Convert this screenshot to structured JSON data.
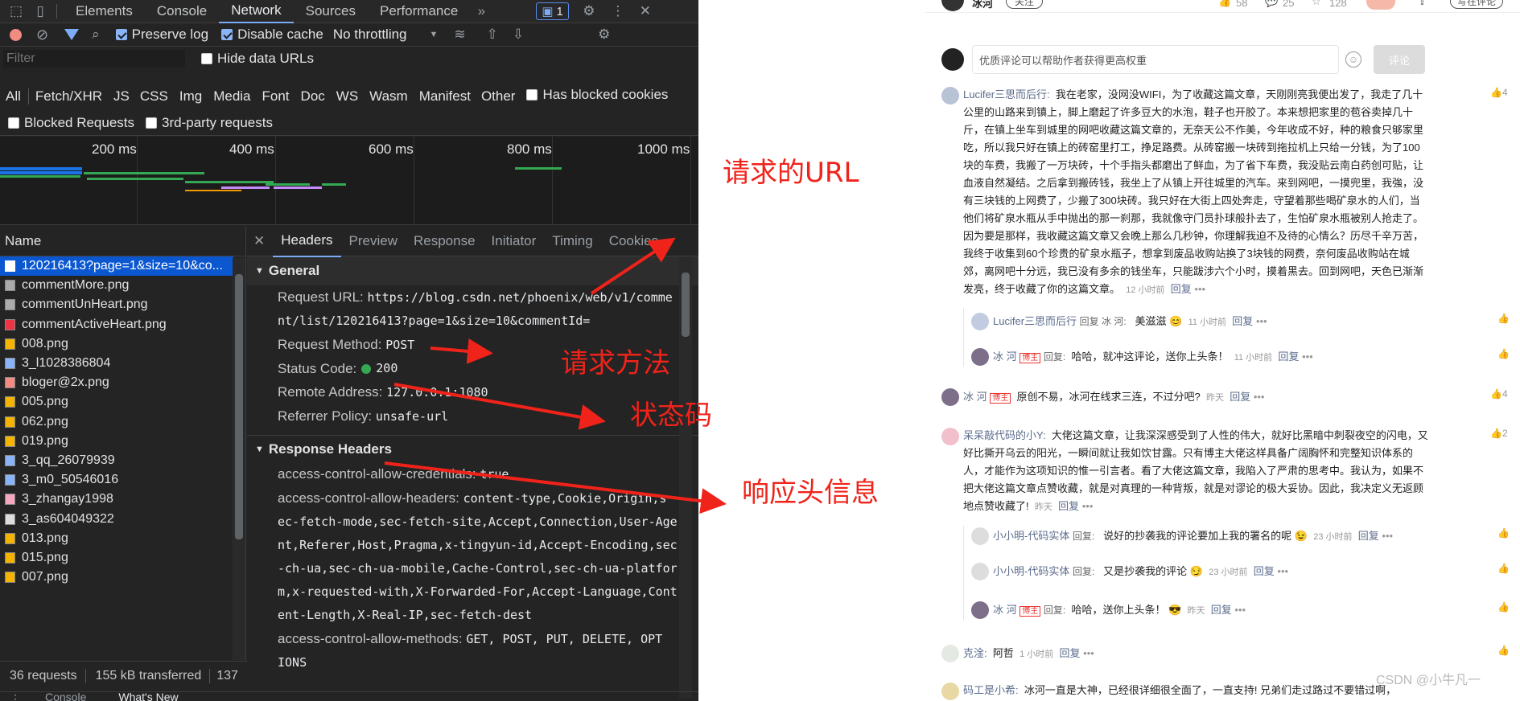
{
  "devtools": {
    "top_tabs": [
      "Elements",
      "Console",
      "Network",
      "Sources",
      "Performance"
    ],
    "more": "»",
    "issues_count": "1",
    "toolbar": {
      "preserve_log": "Preserve log",
      "disable_cache": "Disable cache",
      "throttling": "No throttling"
    },
    "filter": {
      "placeholder": "Filter",
      "hide_data_urls": "Hide data URLs"
    },
    "type_filters": [
      "All",
      "Fetch/XHR",
      "JS",
      "CSS",
      "Img",
      "Media",
      "Font",
      "Doc",
      "WS",
      "Wasm",
      "Manifest",
      "Other"
    ],
    "has_blocked_cookies": "Has blocked cookies",
    "blocked_requests": "Blocked Requests",
    "third_party": "3rd-party requests",
    "timeline_ticks": [
      "200 ms",
      "400 ms",
      "600 ms",
      "800 ms",
      "1000 ms"
    ],
    "name_header": "Name",
    "requests": [
      "120216413?page=1&size=10&co...",
      "commentMore.png",
      "commentUnHeart.png",
      "commentActiveHeart.png",
      "008.png",
      "3_l1028386804",
      "bloger@2x.png",
      "005.png",
      "062.png",
      "019.png",
      "3_qq_26079939",
      "3_m0_50546016",
      "3_zhangay1998",
      "3_as604049322",
      "013.png",
      "015.png",
      "007.png"
    ],
    "status": {
      "requests": "36 requests",
      "transferred": "155 kB transferred",
      "more": "137"
    },
    "detail_tabs": [
      "Headers",
      "Preview",
      "Response",
      "Initiator",
      "Timing",
      "Cookies"
    ],
    "general": {
      "title": "General",
      "url_label": "Request URL:",
      "url_line1": "https://blog.csdn.net/phoenix/web/v1/comme",
      "url_line2": "nt/list/120216413?page=1&size=10&commentId=",
      "method_label": "Request Method:",
      "method": "POST",
      "status_label": "Status Code:",
      "status": "200",
      "remote_label": "Remote Address:",
      "remote": "127.0.0.1:1080",
      "referrer_label": "Referrer Policy:",
      "referrer": "unsafe-url"
    },
    "response_headers": {
      "title": "Response Headers",
      "credentials_label": "access-control-allow-credentials:",
      "credentials": "true",
      "headers_label": "access-control-allow-headers:",
      "headers_lines": [
        "content-type,Cookie,Origin,s",
        "ec-fetch-mode,sec-fetch-site,Accept,Connection,User-Age",
        "nt,Referer,Host,Pragma,x-tingyun-id,Accept-Encoding,sec",
        "-ch-ua,sec-ch-ua-mobile,Cache-Control,sec-ch-ua-platfor",
        "m,x-requested-with,X-Forwarded-For,Accept-Language,Cont",
        "ent-Length,X-Real-IP,sec-fetch-dest"
      ],
      "methods_label": "access-control-allow-methods:",
      "methods_line1": "GET, POST, PUT, DELETE, OPT",
      "methods_line2": "IONS"
    },
    "drawer_tabs": [
      "Console",
      "What's New"
    ]
  },
  "annotations": {
    "url": "请求的URL",
    "method": "请求方法",
    "status": "状态码",
    "headers": "响应头信息"
  },
  "csdn": {
    "author": "冰河",
    "follow": "关注",
    "counts": [
      "58",
      "25",
      "128"
    ],
    "header_btn": "写在评论",
    "comment_placeholder": "优质评论可以帮助作者获得更高权重",
    "comment_btn": "评论",
    "comments": [
      {
        "name": "Lucifer三思而后行:",
        "text": "我在老家，没网没WIFI，为了收藏这篇文章，天刚刚亮我便出发了，我走了几十公里的山路来到镇上，脚上磨起了许多豆大的水泡，鞋子也开胶了。本来想把家里的苞谷卖掉几十斤，在镇上坐车到城里的网吧收藏这篇文章的，无奈天公不作美，今年收成不好，种的粮食只够家里吃，所以我只好在镇上的砖窑里打工，挣足路费。从砖窑搬一块砖到拖拉机上只给一分钱，为了100块的车费，我搬了一万块砖，十个手指头都磨出了鲜血，为了省下车费，我没贴云南白药创可贴，让血液自然凝结。之后拿到搬砖钱，我坐上了从镇上开往城里的汽车。来到网吧，一摸兜里，我強，没有三块钱的上网费了，少搬了300块砖。我只好在大街上四处奔走，守望着那些喝矿泉水的人们，当他们将矿泉水瓶从手中抛出的那一刹那，我就像守门员扑球般扑去了，生怕矿泉水瓶被别人抢走了。因为要是那样，我收藏这篇文章又会晚上那么几秒钟，你理解我迫不及待的心情么？历尽千辛万苦，我终于收集到60个珍贵的矿泉水瓶子，想拿到废品收购站换了3块钱的网费，奈何废品收购站在城郊，离网吧十分远，我已没有多余的钱坐车，只能跋涉六个小时，摸着黑去。回到网吧，天色已渐渐发亮，终于收藏了你的这篇文章。",
        "time": "12 小时前",
        "reply": "回复",
        "likes": "4"
      },
      {
        "name": "Lucifer三思而后行",
        "reply_to": "回复 冰 河:",
        "text": "美滋滋",
        "time": "11 小时前",
        "reply": "回复"
      },
      {
        "name": "冰 河",
        "badge": "博主",
        "reply_to": "回复:",
        "text": "哈哈，就冲这评论，送你上头条！",
        "time": "11 小时前",
        "reply": "回复"
      },
      {
        "name": "冰 河",
        "badge": "博主",
        "text": "原创不易，冰河在线求三连，不过分吧?",
        "time": "昨天",
        "reply": "回复",
        "likes": "4"
      },
      {
        "name": "呆呆敲代码的小Y:",
        "text": "大佬这篇文章，让我深深感受到了人性的伟大，就好比黑暗中刺裂夜空的闪电，又好比撕开乌云的阳光，一瞬间就让我如饮甘露。只有博主大佬这样具备广阔胸怀和完整知识体系的人，才能作为这项知识的惟一引言者。看了大佬这篇文章，我陷入了严肃的思考中。我认为，如果不把大佬这篇文章点赞收藏，就是对真理的一种背叛，就是对谬论的极大妥协。因此，我决定义无返顾地点赞收藏了!",
        "time": "昨天",
        "reply": "回复",
        "likes": "2"
      },
      {
        "name": "小小明-代码实体",
        "reply_to": "回复:",
        "text": "说好的抄袭我的评论要加上我的署名的呢",
        "time": "23 小时前",
        "reply": "回复"
      },
      {
        "name": "小小明-代码实体",
        "reply_to": "回复:",
        "text": "又是抄袭我的评论",
        "time": "23 小时前",
        "reply": "回复"
      },
      {
        "name": "冰 河",
        "badge": "博主",
        "reply_to": "回复:",
        "text": "哈哈，送你上头条！",
        "time": "昨天",
        "reply": "回复"
      },
      {
        "name": "克淦:",
        "text": "阿哲",
        "time": "1 小时前",
        "reply": "回复"
      },
      {
        "name": "码工是小希:",
        "text": "冰河一直是大神，已经很详细很全面了，一直支持! 兄弟们走过路过不要错过啊，"
      }
    ],
    "watermark": "CSDN @小牛凡一"
  },
  "colors": {
    "annotation": "#f0231a",
    "accent": "#7cacf8",
    "selected": "#0b57d0",
    "status_ok": "#34a853"
  }
}
